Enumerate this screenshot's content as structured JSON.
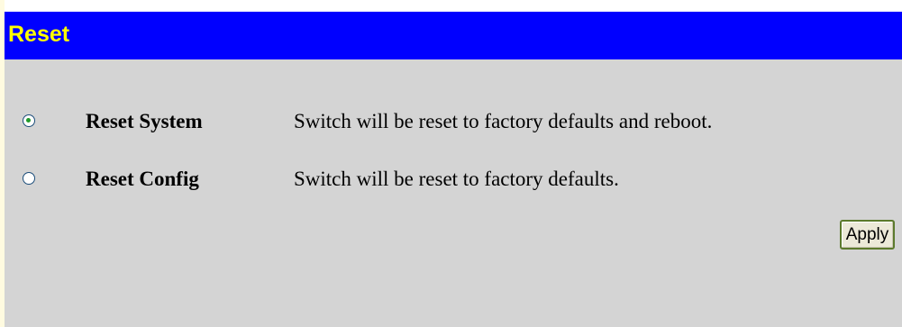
{
  "header": {
    "title": "Reset"
  },
  "options": [
    {
      "label": "Reset System",
      "description": "Switch will be reset to factory defaults and reboot.",
      "selected": true
    },
    {
      "label": "Reset Config",
      "description": "Switch will be reset to factory defaults.",
      "selected": false
    }
  ],
  "actions": {
    "apply_label": "Apply"
  },
  "colors": {
    "header_background": "#0000ff",
    "header_text": "#ffff00",
    "panel_background": "#d4d4d4",
    "radio_selected_dot": "#1f9a2a"
  }
}
